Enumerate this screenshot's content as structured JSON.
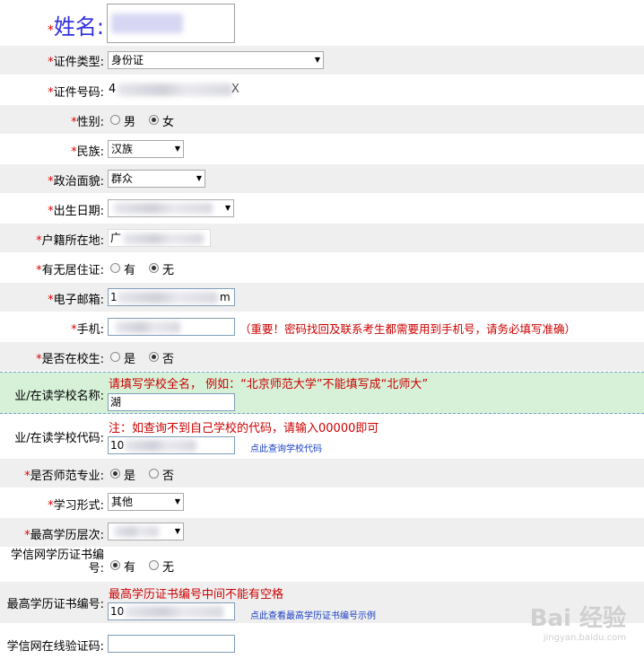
{
  "name_row": {
    "req": "*",
    "label": "姓名:"
  },
  "id_type": {
    "req": "*",
    "label": "证件类型:",
    "value": "身份证"
  },
  "id_number": {
    "req": "*",
    "label": "证件号码:",
    "prefix": "4",
    "suffix": "X"
  },
  "gender": {
    "req": "*",
    "label": "性别:",
    "opt1": "男",
    "opt2": "女",
    "selected": "女"
  },
  "ethnicity": {
    "req": "*",
    "label": "民族:",
    "value": "汉族"
  },
  "political": {
    "req": "*",
    "label": "政治面貌:",
    "value": "群众"
  },
  "birth": {
    "req": "*",
    "label": "出生日期:"
  },
  "household": {
    "req": "*",
    "label": "户籍所在地:",
    "prefix": "广"
  },
  "residence": {
    "req": "*",
    "label": "有无居住证:",
    "opt1": "有",
    "opt2": "无",
    "selected": "无"
  },
  "email": {
    "req": "*",
    "label": "电子邮箱:",
    "prefix": "1",
    "suffix": "m"
  },
  "phone": {
    "req": "*",
    "label": "手机:",
    "note": "（重要！密码找回及联系考生都需要用到手机号，请务必填写准确）"
  },
  "in_school": {
    "req": "*",
    "label": "是否在校生:",
    "opt1": "是",
    "opt2": "否",
    "selected": "否"
  },
  "school_name": {
    "label": "业/在读学校名称:",
    "note": "请填写学校全名， 例如：“北京师范大学”不能填写成“北师大”",
    "prefix": "湖"
  },
  "school_code": {
    "label": "业/在读学校代码:",
    "note": "注：如查询不到自己学校的代码，请输入00000即可",
    "prefix": "10",
    "link": "点此查询学校代码"
  },
  "normal_major": {
    "req": "*",
    "label": "是否师范专业:",
    "opt1": "是",
    "opt2": "否",
    "selected": "是"
  },
  "study_form": {
    "req": "*",
    "label": "学习形式:",
    "value": "其他"
  },
  "edu_level": {
    "req": "*",
    "label": "最高学历层次:"
  },
  "chsi_cert": {
    "label1": "学信网学历证书编",
    "label2": "号:",
    "opt1": "有",
    "opt2": "无",
    "selected": "有"
  },
  "cert_number": {
    "label": "最高学历证书编号:",
    "note": "最高学历证书编号中间不能有空格",
    "prefix": "10",
    "link": "点此查看最高学历证书编号示例"
  },
  "verify_code": {
    "label": "学信网在线验证码:"
  },
  "watermark": {
    "brand": "Bai 经验",
    "url": "jingyan.baidu.com"
  },
  "colors": {
    "required": "#e00000",
    "name_label": "#3030e0",
    "note": "#cc0000",
    "link": "#1a3ec2"
  }
}
